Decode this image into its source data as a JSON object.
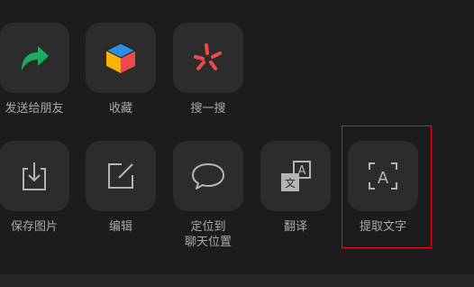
{
  "row1": [
    {
      "label": "发送给朋友",
      "icon": "share-arrow-icon"
    },
    {
      "label": "收藏",
      "icon": "favorites-cube-icon"
    },
    {
      "label": "搜一搜",
      "icon": "search-sparkle-icon"
    }
  ],
  "row2": [
    {
      "label": "保存图片",
      "icon": "save-image-icon"
    },
    {
      "label": "编辑",
      "icon": "edit-icon"
    },
    {
      "label": "定位到\n聊天位置",
      "icon": "chat-bubble-icon"
    },
    {
      "label": "翻译",
      "icon": "translate-icon"
    },
    {
      "label": "提取文字",
      "icon": "extract-text-icon"
    }
  ],
  "translate_glyphs": {
    "front": "文",
    "back": "A"
  },
  "extract_glyph": "A",
  "colors": {
    "tile": "#2c2c2c",
    "label": "#a9a9a9",
    "share_green": "#1aad5b",
    "highlight_red": "#e3141b",
    "search_red": "#ee4a4a"
  }
}
